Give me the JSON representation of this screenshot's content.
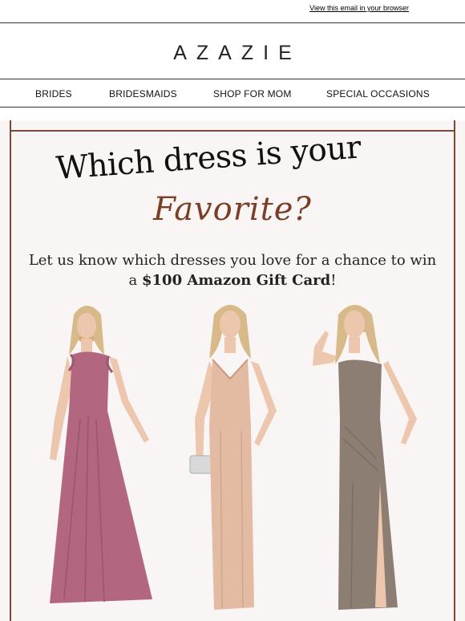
{
  "preheader": {
    "view_in_browser": "View this email in your browser"
  },
  "brand": {
    "logo_text": "AZAZIE"
  },
  "nav": {
    "items": [
      {
        "label": "BRIDES"
      },
      {
        "label": "BRIDESMAIDS"
      },
      {
        "label": "SHOP FOR MOM"
      },
      {
        "label": "SPECIAL OCCASIONS"
      }
    ]
  },
  "hero": {
    "headline_line1": "Which dress is your",
    "headline_line2": "Favorite?",
    "subtext_before": "Let us know which dresses you love for a chance to win a ",
    "subtext_bold": "$100 Amazon Gift Card",
    "subtext_after": "!"
  },
  "colors": {
    "accent_brown": "#7a3e26",
    "frame_brown": "#7a4a36",
    "dress_mauve": "#b2667f",
    "dress_champagne": "#e3bba3",
    "dress_taupe": "#8c7e73"
  },
  "dresses": [
    {
      "color_name": "mauve"
    },
    {
      "color_name": "champagne"
    },
    {
      "color_name": "taupe"
    }
  ]
}
